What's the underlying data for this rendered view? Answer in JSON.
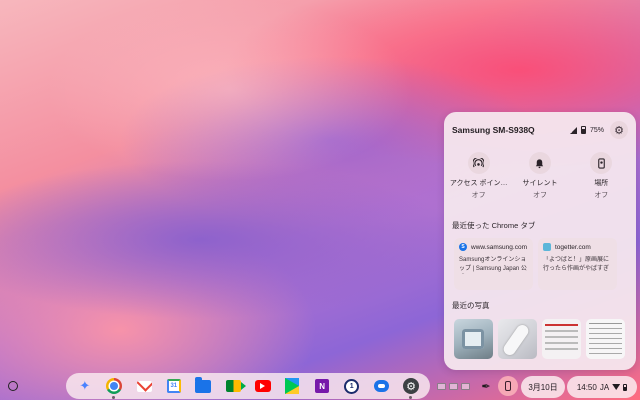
{
  "panel": {
    "device_name": "Samsung SM-S938Q",
    "battery": "75%",
    "toggles": [
      {
        "label": "アクセス ポイン…",
        "state": "オフ",
        "icon": "hotspot-icon"
      },
      {
        "label": "サイレント",
        "state": "オフ",
        "icon": "bell-silent-icon"
      },
      {
        "label": "場所",
        "state": "オフ",
        "icon": "location-phone-icon"
      }
    ],
    "recent_tabs_title": "最近使った Chrome タブ",
    "tabs": [
      {
        "favicon": "S",
        "url": "www.samsung.com",
        "title": "Samsungオンラインショップ | Samsung Japan 公式"
      },
      {
        "favicon": "",
        "url": "togetter.com",
        "title": "「よつばと！」原画展に行ったら作画がやばすぎて…"
      }
    ],
    "recent_photos_title": "最近の写真"
  },
  "shelf": {
    "apps": [
      "gemini-icon",
      "chrome-icon",
      "gmail-icon",
      "calendar-icon",
      "files-icon",
      "meet-icon",
      "youtube-icon",
      "play-store-icon",
      "onenote-icon",
      "onepassword-icon",
      "messages-icon",
      "settings-icon"
    ],
    "calendar_day": "31",
    "onenote_letter": "N",
    "onepassword_letter": "1"
  },
  "tray": {
    "date": "3月10日",
    "time": "14:50",
    "ime": "JA"
  },
  "colors": {
    "panel_bg": "#f5e8ee",
    "phone_hub_active": "#f6a8b6"
  }
}
